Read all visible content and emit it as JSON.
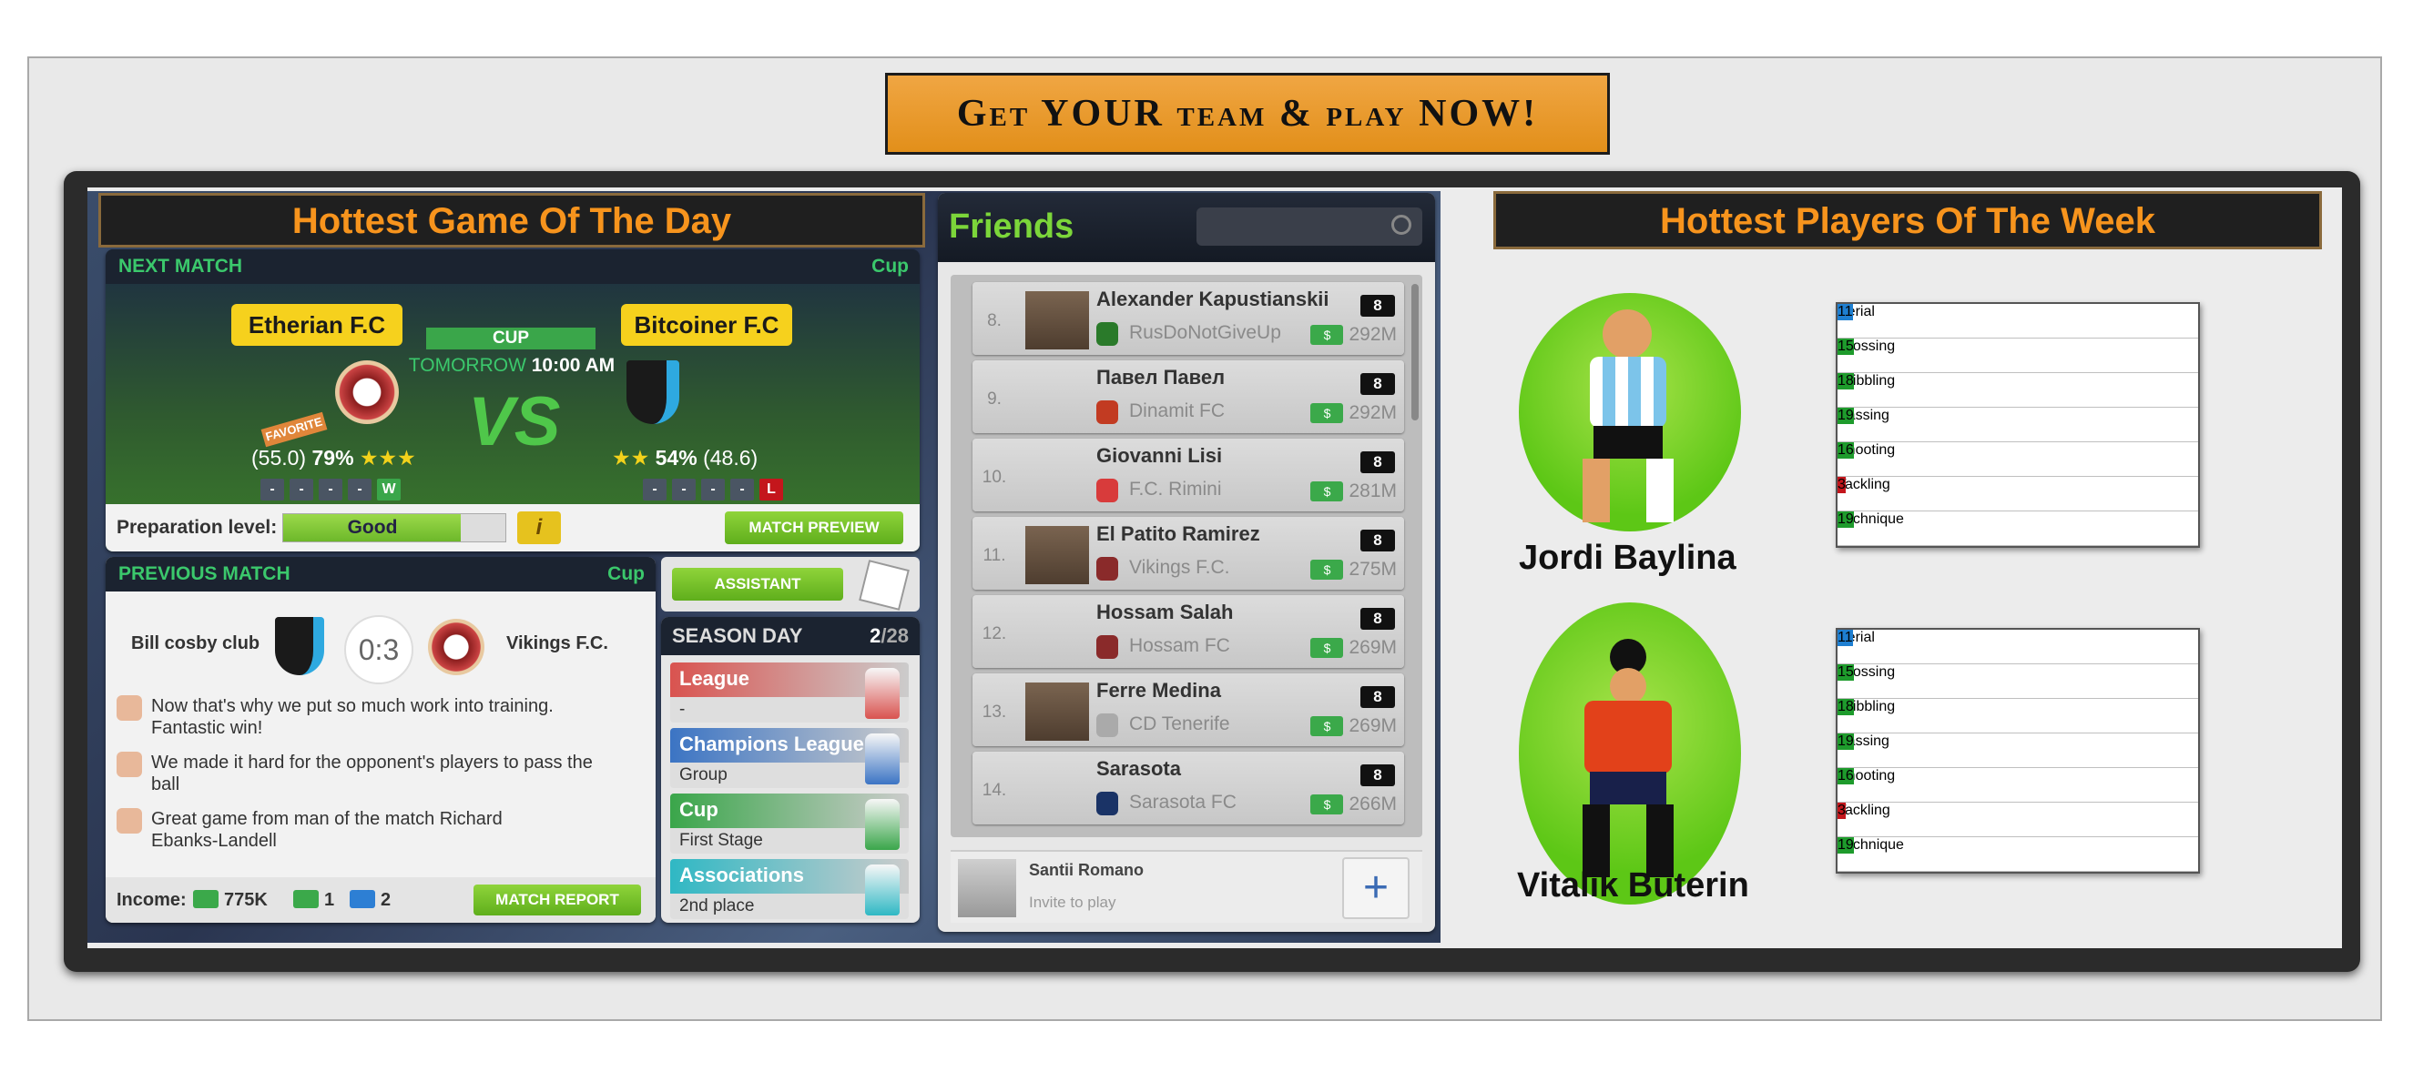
{
  "banner": "Get YOUR team & play NOW!",
  "left_header": "Hottest Game Of The Day",
  "right_header": "Hottest Players Of The Week",
  "next_match": {
    "title": "NEXT MATCH",
    "type": "Cup",
    "home": "Etherian F.C",
    "away": "Bitcoiner F.C",
    "badge": "CUP",
    "time_prefix": "TOMORROW",
    "time": "10:00 AM",
    "vs": "VS",
    "favorite": "FAVORITE",
    "home_rating": "(55.0)",
    "home_pct": "79%",
    "away_pct": "54%",
    "away_rating": "(48.6)",
    "home_form": [
      "-",
      "-",
      "-",
      "-",
      "W"
    ],
    "away_form": [
      "-",
      "-",
      "-",
      "-",
      "L"
    ],
    "prep_label": "Preparation level:",
    "prep_value": "Good",
    "prep_fraction": 0.8,
    "info": "i",
    "preview_btn": "MATCH PREVIEW"
  },
  "prev_match": {
    "title": "PREVIOUS MATCH",
    "type": "Cup",
    "home": "Bill cosby club",
    "score": "0:3",
    "away": "Vikings F.C.",
    "comments": [
      "Now that's why we put so much work into training. Fantastic win!",
      "We made it hard for the opponent's players to pass the ball",
      "Great game from man of the match Richard Ebanks-Landell"
    ],
    "income_label": "Income:",
    "income": "775K",
    "tokens": "1",
    "boosts": "2",
    "report_btn": "MATCH REPORT"
  },
  "assistant_btn": "ASSISTANT",
  "season": {
    "title": "SEASON DAY",
    "day": "2",
    "total": "/28",
    "comps": [
      {
        "name": "League",
        "sub": "-",
        "color": "#d9534f"
      },
      {
        "name": "Champions League",
        "sub": "Group",
        "color": "#3b74c4"
      },
      {
        "name": "Cup",
        "sub": "First Stage",
        "color": "#3aa64a"
      },
      {
        "name": "Associations",
        "sub": "2nd place",
        "color": "#2fb8c4"
      }
    ]
  },
  "friends": {
    "title": "Friends",
    "search_icon": "search-icon",
    "rows": [
      {
        "rank": "8.",
        "name": "Alexander Kapustianskii",
        "club": "RusDoNotGiveUp",
        "level": "8",
        "money": "292M"
      },
      {
        "rank": "9.",
        "name": "Павел Павел",
        "club": "Dinamit FC",
        "level": "8",
        "money": "292M"
      },
      {
        "rank": "10.",
        "name": "Giovanni Lisi",
        "club": "F.C. Rimini",
        "level": "8",
        "money": "281M"
      },
      {
        "rank": "11.",
        "name": "El Patito Ramirez",
        "club": "Vikings F.C.",
        "level": "8",
        "money": "275M"
      },
      {
        "rank": "12.",
        "name": "Hossam Salah",
        "club": "Hossam FC",
        "level": "8",
        "money": "269M"
      },
      {
        "rank": "13.",
        "name": "Ferre Medina",
        "club": "CD Tenerife",
        "level": "8",
        "money": "269M"
      },
      {
        "rank": "14.",
        "name": "Sarasota",
        "club": "Sarasota FC",
        "level": "8",
        "money": "266M"
      }
    ],
    "invite_name": "Santii Romano",
    "invite_sub": "Invite to play",
    "add": "+"
  },
  "players": [
    {
      "name": "Jordi Baylina",
      "stats": [
        {
          "k": "Aerial",
          "v": "11",
          "c": "#1e7fd1"
        },
        {
          "k": "Crossing",
          "v": "15",
          "c": "#1e9b2c"
        },
        {
          "k": "Dribbling",
          "v": "18",
          "c": "#1e9b2c"
        },
        {
          "k": "Passing",
          "v": "19",
          "c": "#1e9b2c"
        },
        {
          "k": "Shooting",
          "v": "16",
          "c": "#1e9b2c"
        },
        {
          "k": "Tackling",
          "v": "3",
          "c": "#c4161c"
        },
        {
          "k": "Technique",
          "v": "19",
          "c": "#1e9b2c"
        }
      ]
    },
    {
      "name": "Vitalik Buterin",
      "stats": [
        {
          "k": "Aerial",
          "v": "11",
          "c": "#1e7fd1"
        },
        {
          "k": "Crossing",
          "v": "15",
          "c": "#1e9b2c"
        },
        {
          "k": "Dribbling",
          "v": "18",
          "c": "#1e9b2c"
        },
        {
          "k": "Passing",
          "v": "19",
          "c": "#1e9b2c"
        },
        {
          "k": "Shooting",
          "v": "16",
          "c": "#1e9b2c"
        },
        {
          "k": "Tackling",
          "v": "3",
          "c": "#c4161c"
        },
        {
          "k": "Technique",
          "v": "19",
          "c": "#1e9b2c"
        }
      ]
    }
  ]
}
